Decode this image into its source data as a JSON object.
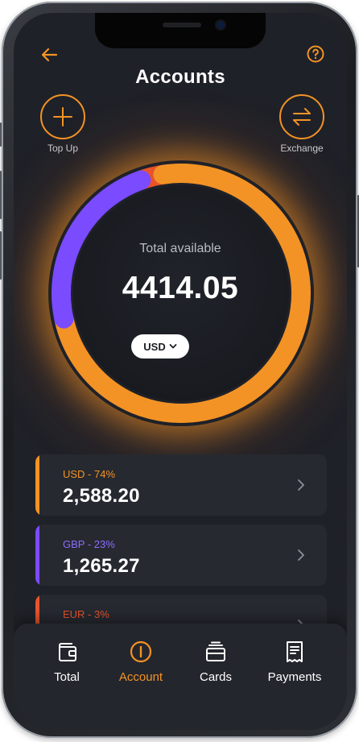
{
  "header": {
    "back_icon": "arrow-left-icon",
    "help_icon": "question-circle-icon",
    "title": "Accounts"
  },
  "actions": {
    "top_up": {
      "label": "Top Up",
      "icon": "plus-icon"
    },
    "exchange": {
      "label": "Exchange",
      "icon": "swap-arrows-icon"
    }
  },
  "summary": {
    "label": "Total available",
    "amount": "4414.05",
    "currency": "USD",
    "currency_icon": "chevron-down-icon"
  },
  "accounts": [
    {
      "label": "USD - 74%",
      "balance": "2,588.20",
      "share": 0.74,
      "color": "#f39325"
    },
    {
      "label": "GBP - 23%",
      "balance": "1,265.27",
      "share": 0.23,
      "color": "#7a4bff"
    },
    {
      "label": "EUR - 3%",
      "balance": "",
      "share": 0.03,
      "color": "#e8532c"
    }
  ],
  "tabs": [
    {
      "label": "Total",
      "icon": "wallet-icon",
      "active": false
    },
    {
      "label": "Account",
      "icon": "account-circle-icon",
      "active": true
    },
    {
      "label": "Cards",
      "icon": "cards-icon",
      "active": false
    },
    {
      "label": "Payments",
      "icon": "receipt-icon",
      "active": false
    }
  ],
  "colors": {
    "accent": "#f39325",
    "gbp": "#7a4bff",
    "eur": "#e8532c",
    "background": "#1f2128"
  }
}
